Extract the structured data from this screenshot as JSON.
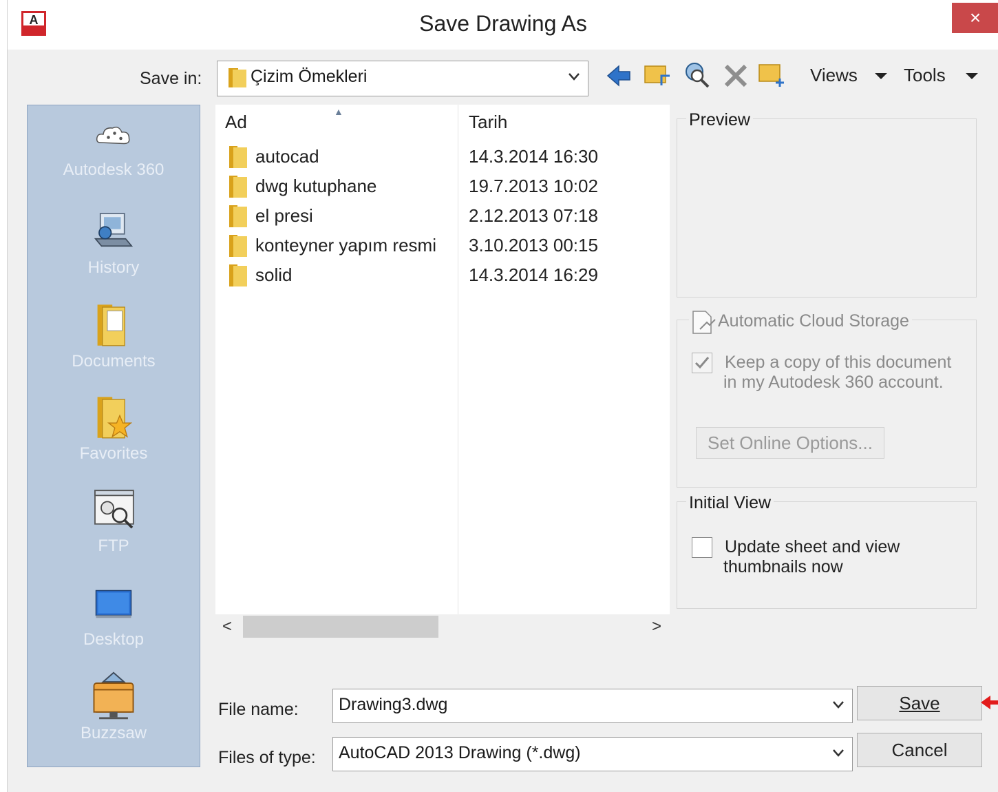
{
  "window": {
    "title": "Save Drawing As",
    "close_glyph": "×",
    "accent_close": "#c9484a"
  },
  "save_in": {
    "label": "Save in:",
    "value": "Çizim Ömekleri"
  },
  "toolbar": {
    "views_label": "Views",
    "tools_label": "Tools"
  },
  "places": [
    {
      "label": "Autodesk 360",
      "icon": "cloud-icon"
    },
    {
      "label": "History",
      "icon": "history-icon"
    },
    {
      "label": "Documents",
      "icon": "documents-icon"
    },
    {
      "label": "Favorites",
      "icon": "favorites-icon"
    },
    {
      "label": "FTP",
      "icon": "ftp-icon"
    },
    {
      "label": "Desktop",
      "icon": "desktop-icon"
    },
    {
      "label": "Buzzsaw",
      "icon": "buzzsaw-icon"
    }
  ],
  "file_list": {
    "columns": [
      "Ad",
      "Tarih"
    ],
    "rows": [
      {
        "name": "autocad",
        "date": "14.3.2014 16:30"
      },
      {
        "name": "dwg kutuphane",
        "date": "19.7.2013 10:02"
      },
      {
        "name": "el presi",
        "date": "2.12.2013 07:18"
      },
      {
        "name": "konteyner yapım resmi",
        "date": "3.10.2013 00:15"
      },
      {
        "name": "solid",
        "date": "14.3.2014 16:29"
      }
    ],
    "scroll_left": "<",
    "scroll_right": ">"
  },
  "preview": {
    "title": "Preview"
  },
  "cloud": {
    "title": "Automatic Cloud Storage",
    "keep_copy_line1": "Keep a copy of this document",
    "keep_copy_line2": "in my Autodesk 360 account.",
    "keep_copy_checked": true,
    "set_online_button": "Set Online Options..."
  },
  "initial_view": {
    "title": "Initial View",
    "update_line1": "Update sheet and view",
    "update_line2": "thumbnails now",
    "update_checked": false
  },
  "file_name": {
    "label": "File name:",
    "value": "Drawing3.dwg"
  },
  "file_type": {
    "label": "Files of type:",
    "value": "AutoCAD 2013 Drawing (*.dwg)"
  },
  "buttons": {
    "save_label": "Save",
    "cancel_label": "Cancel"
  }
}
